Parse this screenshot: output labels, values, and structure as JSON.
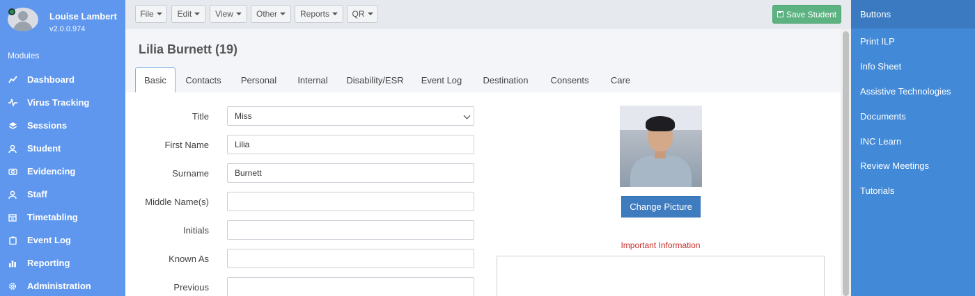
{
  "user": {
    "name": "Louise Lambert",
    "version": "v2.0.0.974"
  },
  "sidebar": {
    "section_title": "Modules",
    "items": [
      {
        "label": "Dashboard",
        "icon": "chart-line-icon"
      },
      {
        "label": "Virus Tracking",
        "icon": "heartbeat-icon"
      },
      {
        "label": "Sessions",
        "icon": "layers-icon"
      },
      {
        "label": "Student",
        "icon": "student-icon"
      },
      {
        "label": "Evidencing",
        "icon": "camera-icon"
      },
      {
        "label": "Staff",
        "icon": "staff-icon"
      },
      {
        "label": "Timetabling",
        "icon": "calendar-icon"
      },
      {
        "label": "Event Log",
        "icon": "clipboard-icon"
      },
      {
        "label": "Reporting",
        "icon": "bar-chart-icon"
      },
      {
        "label": "Administration",
        "icon": "gear-icon"
      }
    ]
  },
  "toolbar": {
    "menus": [
      "File",
      "Edit",
      "View",
      "Other",
      "Reports",
      "QR"
    ],
    "save_label": "Save Student"
  },
  "page": {
    "title": "Lilia Burnett (19)"
  },
  "tabs": [
    "Basic",
    "Contacts",
    "Personal",
    "Internal",
    "Disability/ESR",
    "Event Log",
    "Destination",
    "Consents",
    "Care"
  ],
  "active_tab": "Basic",
  "form": {
    "title": {
      "label": "Title",
      "value": "Miss"
    },
    "first_name": {
      "label": "First Name",
      "value": "Lilia"
    },
    "surname": {
      "label": "Surname",
      "value": "Burnett"
    },
    "middle_names": {
      "label": "Middle Name(s)",
      "value": ""
    },
    "initials": {
      "label": "Initials",
      "value": ""
    },
    "known_as": {
      "label": "Known As",
      "value": ""
    },
    "previous": {
      "label": "Previous",
      "value": ""
    }
  },
  "picture": {
    "change_label": "Change Picture"
  },
  "important": {
    "label": "Important Information",
    "value": ""
  },
  "right_panel": {
    "header": "Buttons",
    "items": [
      "Print ILP",
      "Info Sheet",
      "Assistive Technologies",
      "Documents",
      "INC Learn",
      "Review Meetings",
      "Tutorials"
    ]
  },
  "colors": {
    "sidebar_bg": "#5f97ee",
    "right_panel_bg": "#4289d7",
    "save_button": "#5cb281",
    "change_picture_button": "#3f7bbf",
    "important_label": "#c9302c"
  }
}
